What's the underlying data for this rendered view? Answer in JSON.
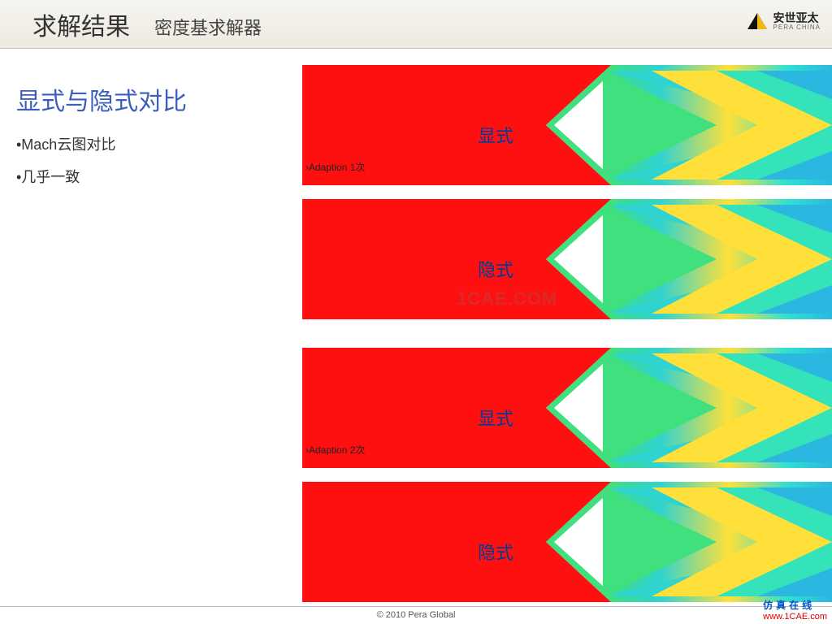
{
  "header": {
    "title": "求解结果",
    "subtitle": "密度基求解器",
    "logo_name": "安世亚太",
    "logo_sub": "PERA CHINA"
  },
  "left": {
    "heading": "显式与隐式对比",
    "bullets": [
      "•Mach云图对比",
      "•几乎一致"
    ]
  },
  "panels": {
    "adaption1": "Adaption 1次",
    "adaption2": "Adaption 2次",
    "label_explicit": "显式",
    "label_implicit": "隐式",
    "bullet_glyph": "›"
  },
  "watermark": "1CAE.COM",
  "footer": {
    "copyright": "© 2010 Pera Global",
    "brand_cn": "仿真在线",
    "brand_url": "www.1CAE.com"
  }
}
